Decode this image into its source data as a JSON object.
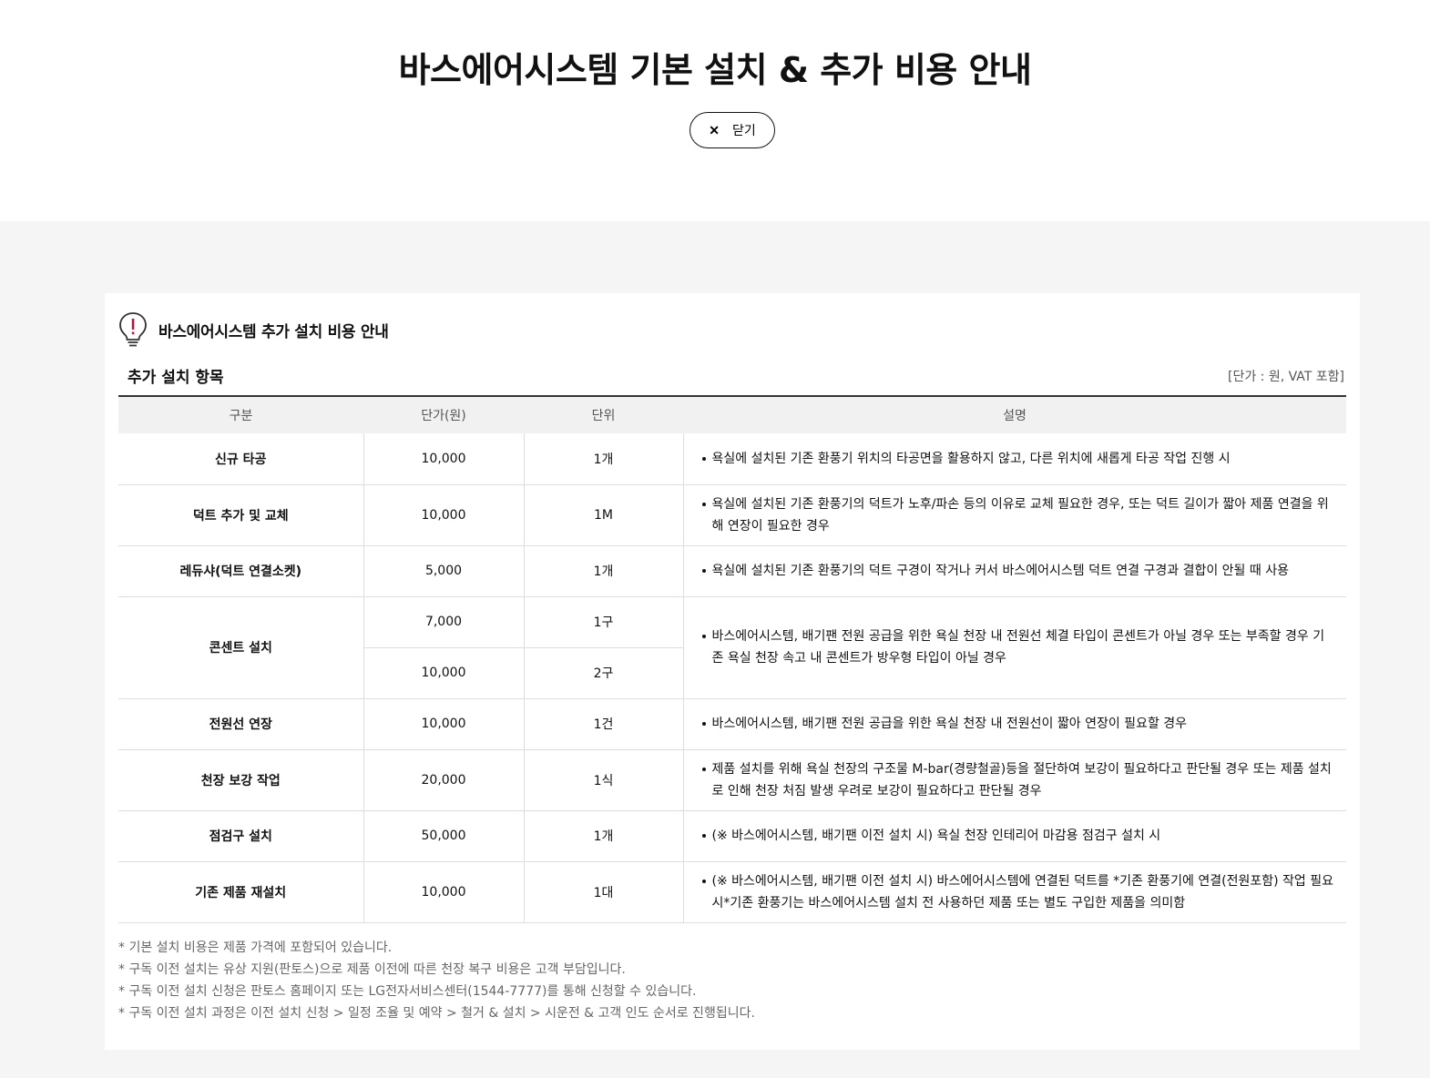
{
  "header": {
    "title": "바스에어시스템 기본 설치 & 추가 비용 안내",
    "close_icon": "close-icon",
    "close_label": "닫기"
  },
  "card": {
    "icon": "lightbulb-alert-icon",
    "title": "바스에어시스템 추가 설치 비용 안내",
    "section_title": "추가 설치 항목",
    "unit_note": "[단가 : 원, VAT 포함]"
  },
  "table": {
    "headers": [
      "구분",
      "단가(원)",
      "단위",
      "설명"
    ],
    "rows": [
      {
        "name": "신규 타공",
        "price": "10,000",
        "unit": "1개",
        "desc": "욕실에 설치된 기존 환풍기 위치의 타공면을 활용하지 않고, 다른 위치에 새롭게 타공 작업 진행 시"
      },
      {
        "name": "덕트 추가 및 교체",
        "price": "10,000",
        "unit": "1M",
        "desc": "욕실에 설치된 기존 환풍기의 덕트가 노후/파손 등의 이유로 교체 필요한 경우, 또는 덕트 길이가 짧아 제품 연결을 위해 연장이 필요한 경우"
      },
      {
        "name": "레듀샤(덕트 연결소켓)",
        "price": "5,000",
        "unit": "1개",
        "desc": "욕실에 설치된 기존 환풍기의 덕트 구경이 작거나 커서 바스에어시스템 덕트 연결 구경과 결합이 안될 때 사용"
      },
      {
        "name": "콘센트 설치",
        "price": "7,000",
        "unit": "1구",
        "price2": "10,000",
        "unit2": "2구",
        "desc": "바스에어시스템, 배기팬 전원 공급을 위한 욕실 천장 내 전원선 체결 타입이 콘센트가 아닐 경우 또는 부족할 경우 기존 욕실 천장 속고 내 콘센트가 방우형 타입이 아닐 경우"
      },
      {
        "name": "전원선 연장",
        "price": "10,000",
        "unit": "1건",
        "desc": "바스에어시스템, 배기팬 전원 공급을 위한 욕실 천장 내 전원선이 짧아 연장이 필요할 경우"
      },
      {
        "name": "천장 보강 작업",
        "price": "20,000",
        "unit": "1식",
        "desc": "제품 설치를 위해 욕실 천장의 구조물 M-bar(경량철골)등을 절단하여 보강이 필요하다고 판단될 경우 또는 제품 설치로 인해 천장 처짐 발생 우려로 보강이 필요하다고 판단될 경우"
      },
      {
        "name": "점검구 설치",
        "price": "50,000",
        "unit": "1개",
        "desc": "(※ 바스에어시스템, 배기팬 이전 설치 시) 욕실 천장 인테리어 마감용 점검구 설치 시"
      },
      {
        "name": "기존 제품 재설치",
        "price": "10,000",
        "unit": "1대",
        "desc": "(※ 바스에어시스템, 배기팬 이전 설치 시) 바스에어시스템에 연결된 덕트를 *기존 환풍기에 연결(전원포함) 작업 필요시*기존 환풍기는 바스에어시스템 설치 전 사용하던 제품 또는 별도 구입한 제품을 의미함"
      }
    ]
  },
  "notes": [
    "기본 설치 비용은 제품 가격에 포함되어 있습니다.",
    "구독 이전 설치는 유상 지원(판토스)으로 제품 이전에 따른 천장 복구 비용은 고객 부담입니다.",
    "구독 이전 설치 신청은 판토스 홈페이지 또는 LG전자서비스센터(1544-7777)를 통해 신청할 수 있습니다.",
    "구독 이전 설치 과정은 이전 설치 신청 > 일정 조율 및 예약 > 철거 & 설치 > 시운전 & 고객 인도 순서로 진행됩니다."
  ],
  "colors": {
    "accent": "#e0002a",
    "header_bg": "#f1f1f1",
    "page_bg": "#f5f5f5"
  }
}
